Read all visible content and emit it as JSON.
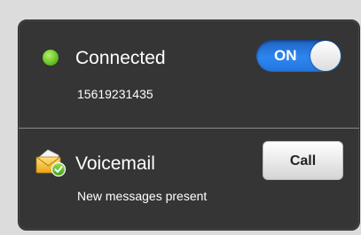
{
  "connection": {
    "status": "Connected",
    "status_color": "#6cc52b",
    "number": "15619231435",
    "toggle": {
      "label": "ON",
      "state": "on",
      "color": "#2d86f0"
    }
  },
  "voicemail": {
    "title": "Voicemail",
    "icon": "voicemail-envelope-icon",
    "subtitle": "New messages present",
    "call_label": "Call"
  }
}
